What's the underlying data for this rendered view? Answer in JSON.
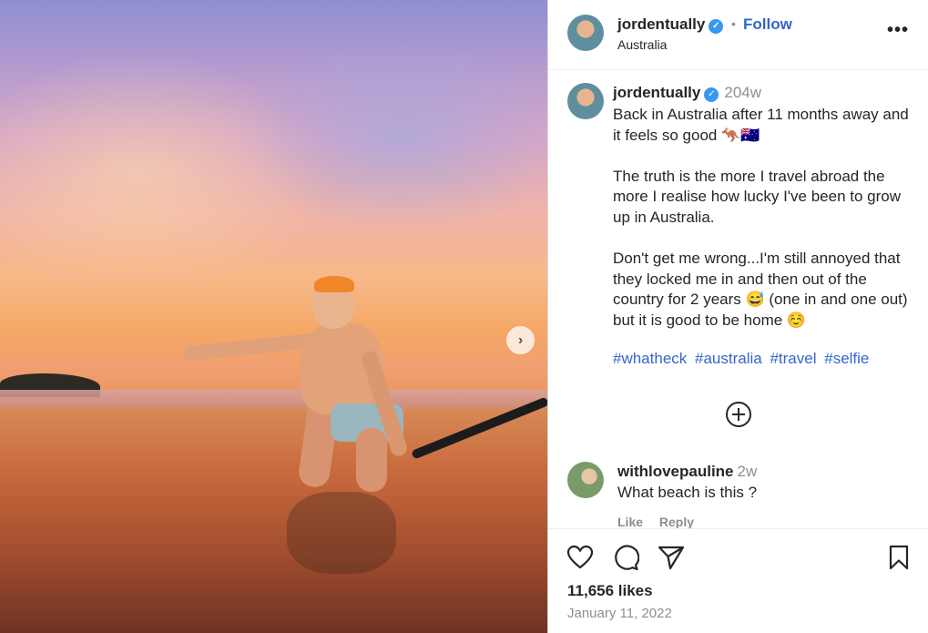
{
  "post": {
    "username": "jordentually",
    "follow_label": "Follow",
    "location": "Australia",
    "more_icon": "more-options-icon"
  },
  "caption": {
    "username": "jordentually",
    "age": "204w",
    "text": "Back in Australia after 11 months away and it feels so good 🦘🇦🇺\n\nThe truth is the more I travel abroad the more I realise how lucky I've been to grow up in Australia.\n\nDon't get me wrong...I'm still annoyed that they locked me in and then out of the country for 2 years 😅 (one in and one out) but it is good to be home ☺️",
    "hashtags": [
      "#whatheck",
      "#australia",
      "#travel",
      "#selfie"
    ]
  },
  "comment": {
    "username": "withlovepauline",
    "age": "2w",
    "text": "What beach is this ?",
    "like_label": "Like",
    "reply_label": "Reply"
  },
  "stats": {
    "likes": "11,656 likes",
    "date": "January 11, 2022"
  },
  "colors": {
    "link_blue": "#3366cc",
    "verified_blue": "#3897f0",
    "muted": "#8e8e8e"
  }
}
